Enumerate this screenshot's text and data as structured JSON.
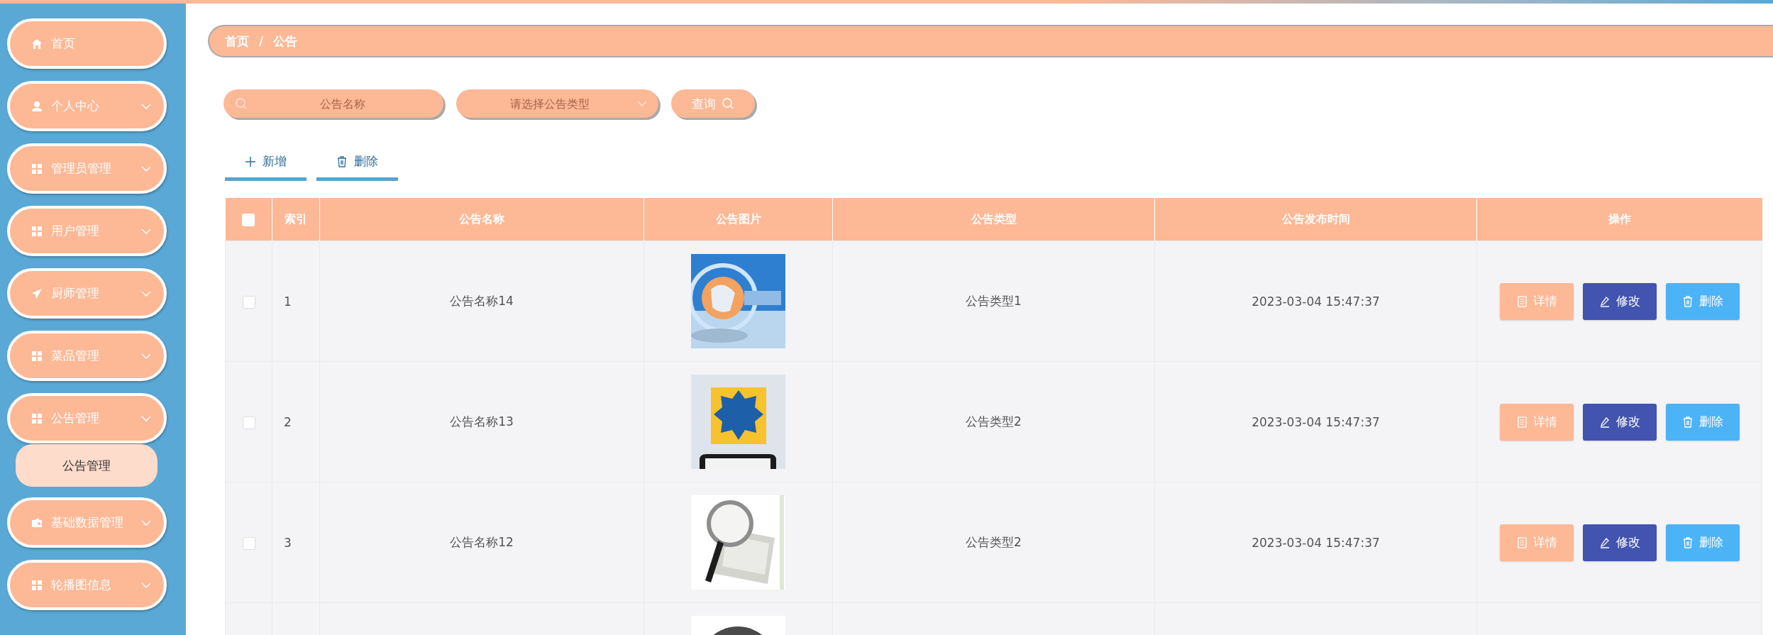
{
  "sidebar": {
    "items": [
      {
        "label": "首页",
        "kind": "home",
        "has_submenu": false
      },
      {
        "label": "个人中心",
        "kind": "user",
        "has_submenu": true
      },
      {
        "label": "管理员管理",
        "kind": "grid",
        "has_submenu": true
      },
      {
        "label": "用户管理",
        "kind": "grid",
        "has_submenu": true
      },
      {
        "label": "厨师管理",
        "kind": "send",
        "has_submenu": true
      },
      {
        "label": "菜品管理",
        "kind": "grid",
        "has_submenu": true
      },
      {
        "label": "公告管理",
        "kind": "grid",
        "has_submenu": true,
        "expanded": true,
        "children": [
          {
            "label": "公告管理"
          }
        ]
      },
      {
        "label": "基础数据管理",
        "kind": "folder",
        "has_submenu": true
      },
      {
        "label": "轮播图信息",
        "kind": "grid",
        "has_submenu": true
      }
    ]
  },
  "breadcrumb": [
    "首页",
    "/",
    "公告"
  ],
  "search": {
    "name_field": {
      "placeholder": "公告名称"
    },
    "type_select": {
      "placeholder": "请选择公告类型"
    },
    "button": "查询"
  },
  "toolbar": [
    {
      "kind": "add",
      "label": "新增"
    },
    {
      "kind": "delete",
      "label": "删除"
    }
  ],
  "table": {
    "columns": [
      {
        "kind": "checkbox",
        "checked": false
      },
      {
        "kind": "text",
        "label": "索引"
      },
      {
        "kind": "text",
        "label": "公告名称"
      },
      {
        "kind": "text",
        "label": "公告图片"
      },
      {
        "kind": "text",
        "label": "公告类型"
      },
      {
        "kind": "text",
        "label": "公告发布时间"
      },
      {
        "kind": "text",
        "label": "操作"
      }
    ],
    "rows": [
      {
        "checked": false,
        "index": "1",
        "name": "公告名称14",
        "image": {
          "kind": "picture"
        },
        "type": "公告类型1",
        "time": "2023-03-04 15:47:37",
        "actions": [
          {
            "kind": "detail",
            "label": "详情"
          },
          {
            "kind": "edit",
            "label": "修改"
          },
          {
            "kind": "delete",
            "label": "删除"
          }
        ]
      },
      {
        "checked": false,
        "index": "2",
        "name": "公告名称13",
        "image": {
          "kind": "picture"
        },
        "type": "公告类型2",
        "time": "2023-03-04 15:47:37",
        "actions": [
          {
            "kind": "detail",
            "label": "详情"
          },
          {
            "kind": "edit",
            "label": "修改"
          },
          {
            "kind": "delete",
            "label": "删除"
          }
        ]
      },
      {
        "checked": false,
        "index": "3",
        "name": "公告名称12",
        "image": {
          "kind": "picture"
        },
        "type": "公告类型2",
        "time": "2023-03-04 15:47:37",
        "actions": [
          {
            "kind": "detail",
            "label": "详情"
          },
          {
            "kind": "edit",
            "label": "修改"
          },
          {
            "kind": "delete",
            "label": "删除"
          }
        ]
      },
      {
        "image": {
          "kind": "picture"
        }
      }
    ]
  }
}
